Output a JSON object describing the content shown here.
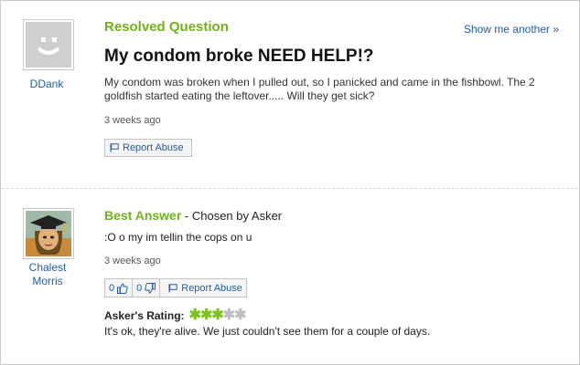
{
  "question": {
    "status_label": "Resolved Question",
    "show_another": "Show me another »",
    "title": "My condom broke NEED HELP!?",
    "body": "My condom was broken when I pulled out, so I panicked and came in the fishbowl. The 2 goldfish started eating the leftover..... Will they get sick?",
    "time_ago": "3 weeks ago",
    "report_label": "Report Abuse",
    "asker_name": "DDank"
  },
  "answer": {
    "heading": "Best Answer",
    "chosen_by": " - Chosen by Asker",
    "body": ":O o my im tellin the cops on u",
    "time_ago": "3 weeks ago",
    "thumbs_up_count": "0",
    "thumbs_down_count": "0",
    "report_label": "Report Abuse",
    "answerer_name": "Chalest Morris"
  },
  "rating": {
    "label": "Asker's Rating:",
    "stars_filled": 3,
    "stars_total": 5,
    "comment": "It's ok, they're alive. We just couldn't see them for a couple of days."
  },
  "colors": {
    "accent_green": "#6fb31b",
    "link_blue": "#1f5fa8",
    "star_on": "#7ac41d",
    "star_off": "#bdbdbd"
  }
}
